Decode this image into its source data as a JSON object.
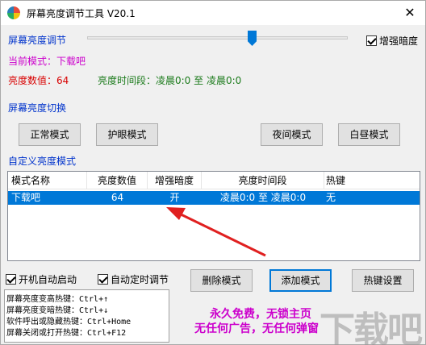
{
  "window": {
    "title": "屏幕亮度调节工具 V20.1",
    "close_label": "✕"
  },
  "brightness": {
    "label": "屏幕亮度调节",
    "slider_level_percent": 62,
    "enhance_label": "增强暗度",
    "enhance_checked": true
  },
  "status": {
    "current_mode": "当前模式：下载吧",
    "brightness_value": "亮度数值：64",
    "time_range": "亮度时间段：凌晨0:0 至 凌晨0:0"
  },
  "switch": {
    "label": "屏幕亮度切换",
    "buttons": [
      "正常模式",
      "护眼模式",
      "夜间模式",
      "白昼模式"
    ]
  },
  "custom": {
    "label": "自定义亮度模式",
    "columns": [
      "模式名称",
      "亮度数值",
      "增强暗度",
      "亮度时间段",
      "热键"
    ],
    "rows": [
      {
        "name": "下载吧",
        "value": "64",
        "enhance": "开",
        "time": "凌晨0:0 至 凌晨0:0",
        "hotkey": "无"
      }
    ]
  },
  "options": {
    "autostart_label": "开机自动启动",
    "autostart_checked": true,
    "timer_label": "自动定时调节",
    "timer_checked": true
  },
  "actions": {
    "delete": "删除模式",
    "add": "添加模式",
    "hotkey_settings": "热键设置"
  },
  "hotkeys": [
    "屏幕亮度变高热键：Ctrl+↑",
    "屏幕亮度变暗热键：Ctrl+↓",
    "软件呼出或隐藏热键：Ctrl+Home",
    "屏幕关闭或打开热键：Ctrl+F12"
  ],
  "promo": {
    "line1": "永久免费，无锁主页",
    "line2": "无任何广告，无任何弹窗"
  },
  "watermark": "下载吧",
  "colors": {
    "accent": "#0078d7",
    "arrow": "#e02020"
  }
}
